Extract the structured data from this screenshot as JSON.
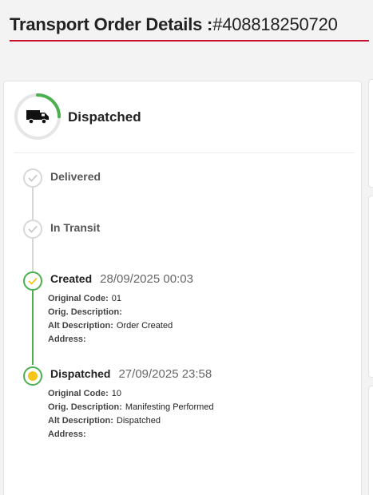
{
  "header": {
    "title_prefix": "Transport Order Details :",
    "order_number": "#408818250720"
  },
  "status": {
    "current": "Dispatched",
    "icon": "truck-icon",
    "progress": 0.25,
    "progress_color": "#4caf50"
  },
  "timeline": [
    {
      "label": "Delivered",
      "state": "pending"
    },
    {
      "label": "In Transit",
      "state": "pending"
    },
    {
      "label": "Created",
      "date": "28/09/2025 00:03",
      "state": "done",
      "details": {
        "original_code_label": "Original Code:",
        "original_code": "01",
        "orig_desc_label": "Orig. Description:",
        "orig_desc": "",
        "alt_desc_label": "Alt Description:",
        "alt_desc": "Order Created",
        "address_label": "Address:",
        "address": ""
      }
    },
    {
      "label": "Dispatched",
      "date": "27/09/2025 23:58",
      "state": "current",
      "details": {
        "original_code_label": "Original Code:",
        "original_code": "10",
        "orig_desc_label": "Orig. Description:",
        "orig_desc": "Manifesting Performed",
        "alt_desc_label": "Alt Description:",
        "alt_desc": "Dispatched",
        "address_label": "Address:",
        "address": ""
      }
    }
  ],
  "colors": {
    "accent_red": "#c8102e",
    "done_green": "#4caf50",
    "current_yellow": "#f5c518",
    "pending_grey": "#d6d6d6"
  }
}
